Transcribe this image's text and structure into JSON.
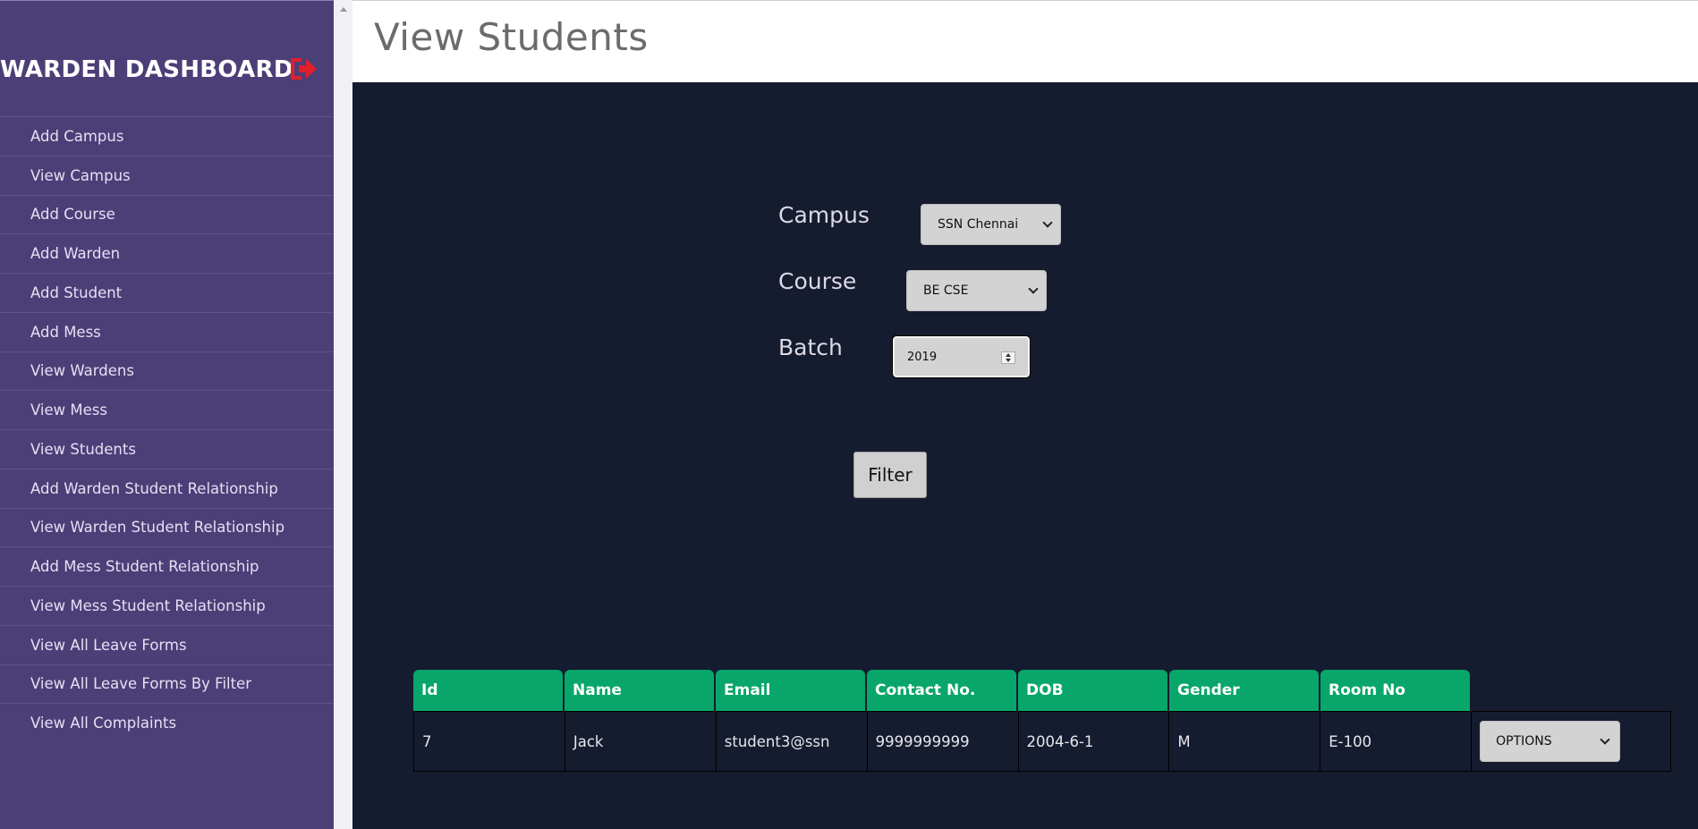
{
  "sidebar": {
    "title": "WARDEN DASHBOARD",
    "logout_icon": "logout-icon",
    "items": [
      {
        "label": "Add Campus"
      },
      {
        "label": "View Campus"
      },
      {
        "label": "Add Course"
      },
      {
        "label": "Add Warden"
      },
      {
        "label": "Add Student"
      },
      {
        "label": "Add Mess"
      },
      {
        "label": "View Wardens"
      },
      {
        "label": "View Mess"
      },
      {
        "label": "View Students"
      },
      {
        "label": "Add Warden Student Relationship"
      },
      {
        "label": "View Warden Student Relationship"
      },
      {
        "label": "Add Mess Student Relationship"
      },
      {
        "label": "View Mess Student Relationship"
      },
      {
        "label": "View All Leave Forms"
      },
      {
        "label": "View All Leave Forms By Filter"
      },
      {
        "label": "View All Complaints"
      }
    ]
  },
  "header": {
    "title": "View Students"
  },
  "filters": {
    "campus": {
      "label": "Campus",
      "value": "SSN Chennai"
    },
    "course": {
      "label": "Course",
      "value": "BE CSE"
    },
    "batch": {
      "label": "Batch",
      "value": "2019"
    },
    "filter_button": "Filter"
  },
  "table": {
    "columns": [
      "Id",
      "Name",
      "Email",
      "Contact No.",
      "DOB",
      "Gender",
      "Room No"
    ],
    "rows": [
      {
        "cells": [
          "7",
          "Jack",
          "student3@ssn",
          "9999999999",
          "2004-6-1",
          "M",
          "E-100"
        ],
        "options_value": "OPTIONS"
      }
    ]
  },
  "colors": {
    "sidebar_bg": "#4c3f78",
    "main_bg": "#151c2f",
    "table_header_bg": "#08a66a",
    "logout_icon": "#e0202a"
  }
}
